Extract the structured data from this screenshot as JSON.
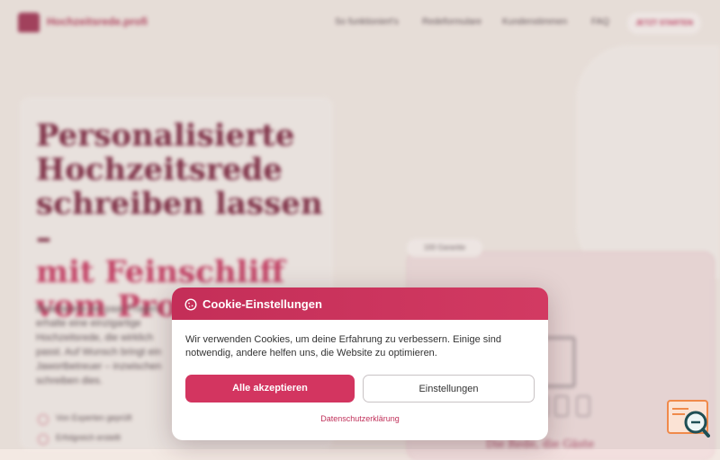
{
  "nav": {
    "brand": "Hochzeitsrede.profi",
    "links": [
      "So funktioniert's",
      "Redeformulare",
      "Kundenstimmen",
      "FAQ"
    ],
    "cta": "JETZT STARTEN"
  },
  "hero": {
    "title_line1": "Personalisierte",
    "title_line2": "Hochzeitsrede",
    "title_line3": "schreiben lassen –",
    "title_accent1": "mit Feinschliff",
    "title_accent2": "vom Profi",
    "body": "Beantworte ein paar Fragen, erhalte eine einzigartige Hochzeitsrede, die wirklich passt. Auf Wunsch bringt ein Jawortbetreuer – inzwischen schreiben dies.",
    "bullets": [
      "Von Experten geprüft",
      "Erfolgreich erstellt"
    ]
  },
  "right": {
    "badge": "100 Garantie",
    "caption": "Die Rede, die Gäste"
  },
  "cookie": {
    "title": " Cookie-Einstellungen",
    "body": "Wir verwenden Cookies, um deine Erfahrung zu verbessern. Einige sind notwendig, andere helfen uns, die Website zu optimieren.",
    "accept_label": "Alle akzeptieren",
    "settings_label": "Einstellungen",
    "privacy_label": "Datenschutzerklärung",
    "accent_color": "#d33560"
  },
  "icons": {
    "cookie": "cookie-icon",
    "brand": "logo-icon",
    "search": "search-widget-icon"
  }
}
